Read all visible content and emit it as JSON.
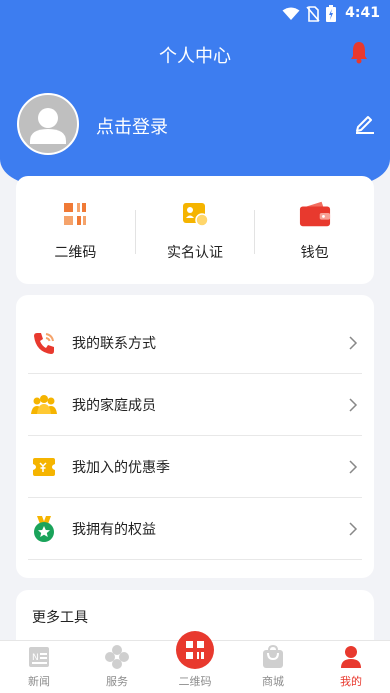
{
  "status_bar": {
    "time": "4:41"
  },
  "header": {
    "title": "个人中心",
    "login_prompt": "点击登录"
  },
  "quick_actions": [
    {
      "label": "二维码",
      "icon": "qrcode-icon"
    },
    {
      "label": "实名认证",
      "icon": "id-card-icon"
    },
    {
      "label": "钱包",
      "icon": "wallet-icon"
    }
  ],
  "menu": [
    {
      "label": "我的联系方式",
      "icon": "phone-icon"
    },
    {
      "label": "我的家庭成员",
      "icon": "family-icon"
    },
    {
      "label": "我加入的优惠季",
      "icon": "coupon-icon"
    },
    {
      "label": "我拥有的权益",
      "icon": "medal-icon"
    }
  ],
  "tools": {
    "title": "更多工具"
  },
  "tabbar": [
    {
      "label": "新闻",
      "icon": "news-icon"
    },
    {
      "label": "服务",
      "icon": "services-icon"
    },
    {
      "label": "二维码",
      "icon": "qrcode-icon"
    },
    {
      "label": "商城",
      "icon": "shopping-bag-icon"
    },
    {
      "label": "我的",
      "icon": "profile-icon",
      "active": true
    }
  ],
  "colors": {
    "primary": "#3d7df0",
    "accent": "#e8392e",
    "background": "#f2f3f7"
  }
}
